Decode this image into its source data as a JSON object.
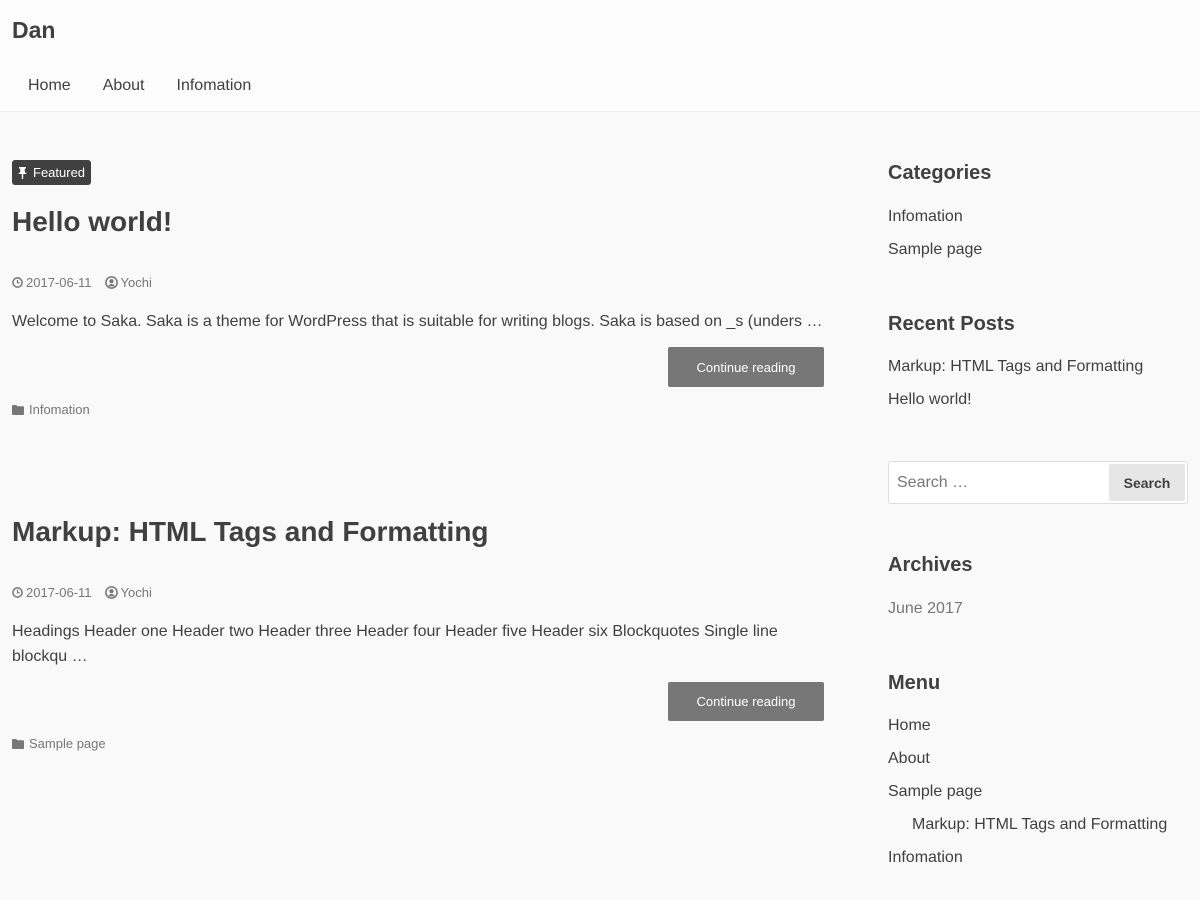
{
  "site": {
    "title": "Dan"
  },
  "nav": [
    {
      "label": "Home"
    },
    {
      "label": "About"
    },
    {
      "label": "Infomation"
    }
  ],
  "posts": [
    {
      "badge": "Featured",
      "title": "Hello world!",
      "date": "2017-06-11",
      "author": "Yochi",
      "summary": "Welcome to Saka. Saka is a theme for WordPress that is suitable for writing blogs. Saka is based on _s (unders …",
      "continue_label": "Continue reading",
      "category": "Infomation"
    },
    {
      "title": "Markup: HTML Tags and Formatting",
      "date": "2017-06-11",
      "author": "Yochi",
      "summary": "Headings Header one Header two Header three Header four Header five Header six Blockquotes Single line blockqu …",
      "continue_label": "Continue reading",
      "category": "Sample page"
    }
  ],
  "sidebar": {
    "categories": {
      "title": "Categories",
      "items": [
        "Infomation",
        "Sample page"
      ]
    },
    "recent_posts": {
      "title": "Recent Posts",
      "items": [
        "Markup: HTML Tags and Formatting",
        "Hello world!"
      ]
    },
    "search": {
      "placeholder": "Search …",
      "button_label": "Search"
    },
    "archives": {
      "title": "Archives",
      "items": [
        "June 2017"
      ]
    },
    "menu": {
      "title": "Menu",
      "items": [
        {
          "label": "Home"
        },
        {
          "label": "About"
        },
        {
          "label": "Sample page"
        },
        {
          "label": "Markup: HTML Tags and Formatting"
        },
        {
          "label": "Infomation"
        }
      ]
    }
  },
  "colors": {
    "text": "#404040",
    "muted": "#777777",
    "button_bg": "#777777",
    "badge_bg": "#404040",
    "page_bg": "#f9f9f9"
  }
}
